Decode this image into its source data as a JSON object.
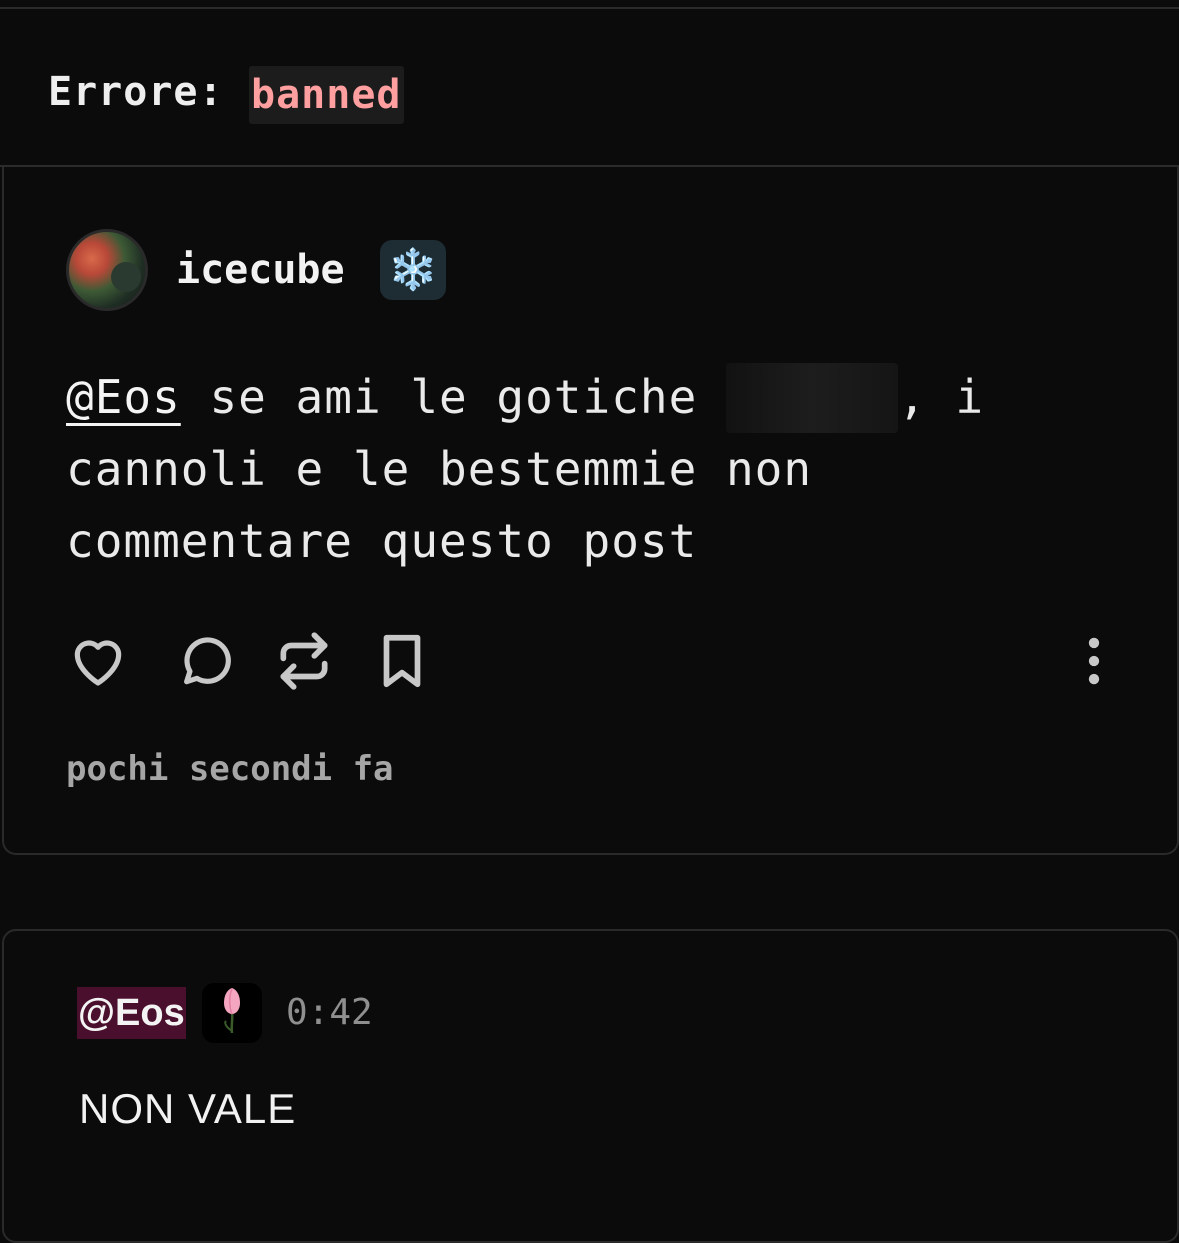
{
  "error": {
    "label": "Errore:",
    "code": "banned"
  },
  "post": {
    "username": "icecube",
    "badge_emoji": "❄️",
    "mention": "@Eos",
    "text_part1": " se ami le gotiche ",
    "text_part2": ", i cannoli e le bestemmie non commentare questo post",
    "timestamp": "pochi secondi fa",
    "actions": [
      "heart-icon",
      "comment-icon",
      "repost-icon",
      "bookmark-icon",
      "more-icon"
    ]
  },
  "reply": {
    "mention": "@Eos",
    "time": "0:42",
    "text": "NON VALE"
  },
  "colors": {
    "background": "#0b0b0b",
    "error_code": "#ff9f9f",
    "reply_mention_bg": "#4a0f2c",
    "badge_bg": "#1e2c33"
  }
}
